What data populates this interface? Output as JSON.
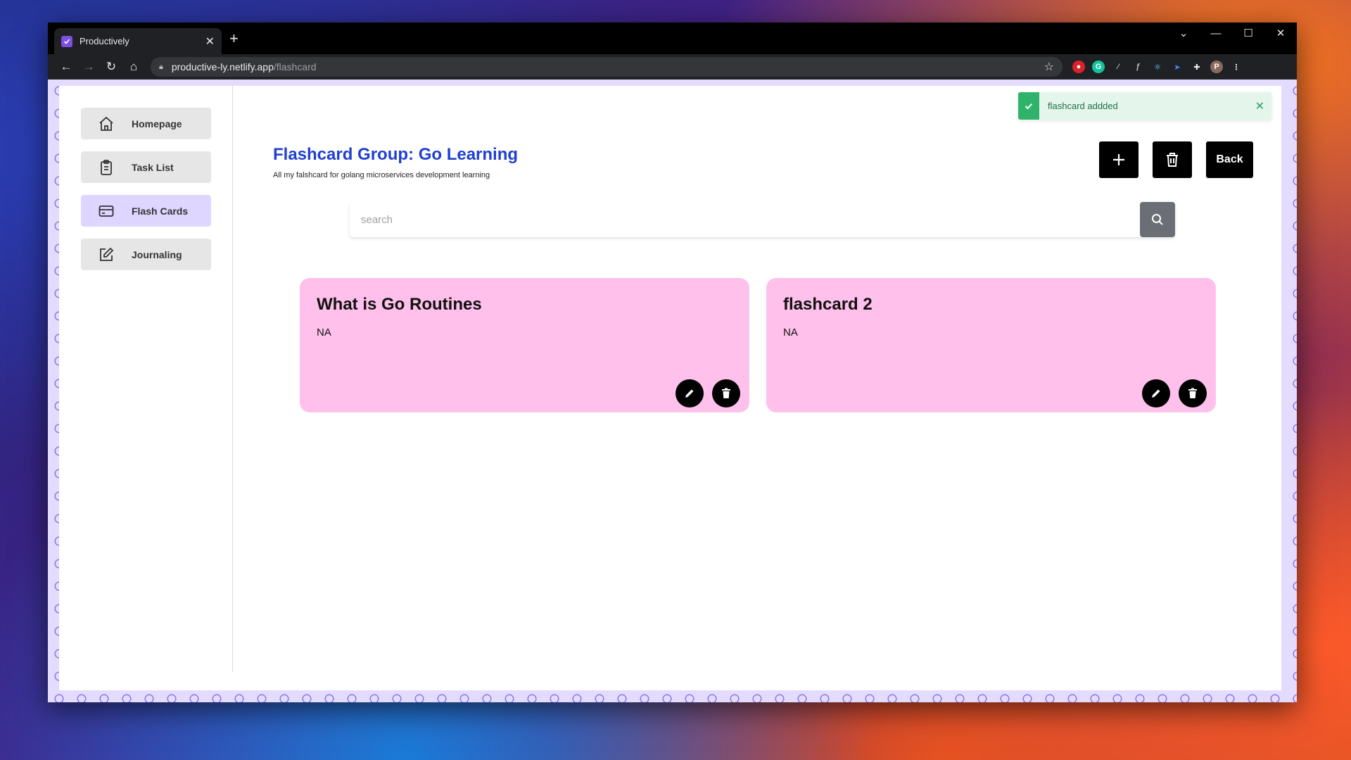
{
  "browser": {
    "tab_title": "Productively",
    "url_host": "productive-ly.netlify.app",
    "url_path": "/flashcard"
  },
  "toast": {
    "message": "flashcard addded",
    "status_color": "#2fb36a"
  },
  "sidebar": {
    "items": [
      {
        "label": "Homepage",
        "icon": "home-icon",
        "active": false
      },
      {
        "label": "Task List",
        "icon": "clipboard-icon",
        "active": false
      },
      {
        "label": "Flash Cards",
        "icon": "card-icon",
        "active": true
      },
      {
        "label": "Journaling",
        "icon": "edit-icon",
        "active": false
      }
    ]
  },
  "header": {
    "title": "Flashcard Group: Go Learning",
    "description": "All my falshcard for golang microservices development learning",
    "back_label": "Back",
    "title_color": "#1f3fd1"
  },
  "search": {
    "placeholder": "search"
  },
  "cards": [
    {
      "title": "What is Go Routines",
      "body": "NA"
    },
    {
      "title": "flashcard 2",
      "body": "NA"
    }
  ],
  "theme": {
    "card_color": "#ffc0ec",
    "active_nav_color": "#ded6ff"
  }
}
